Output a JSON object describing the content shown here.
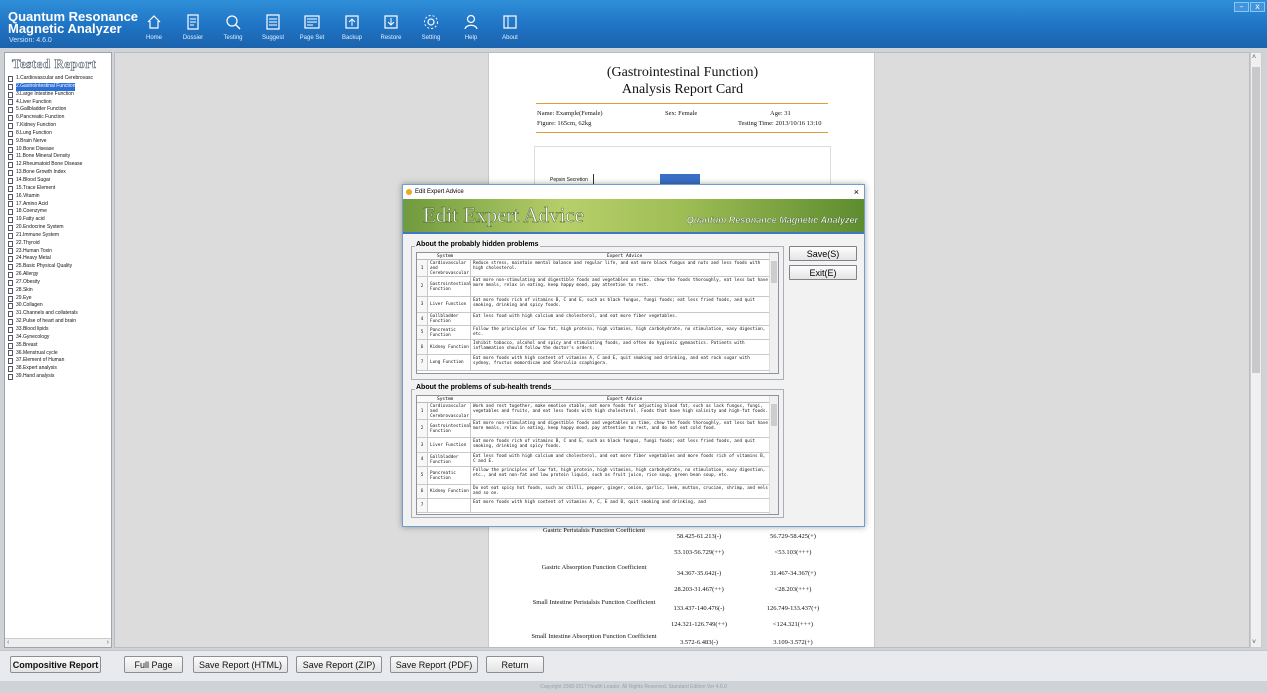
{
  "app": {
    "title_line1": "Quantum Resonance",
    "title_line2": "Magnetic Analyzer",
    "version": "Version: 4.6.0",
    "nav": [
      {
        "icon": "home-icon",
        "label": "Home"
      },
      {
        "icon": "dossier-icon",
        "label": "Dossier"
      },
      {
        "icon": "testing-icon",
        "label": "Testing"
      },
      {
        "icon": "suggest-icon",
        "label": "Suggest"
      },
      {
        "icon": "page-set-icon",
        "label": "Page Set"
      },
      {
        "icon": "backup-icon",
        "label": "Backup"
      },
      {
        "icon": "restore-icon",
        "label": "Restore"
      },
      {
        "icon": "setting-icon",
        "label": "Setting"
      },
      {
        "icon": "help-icon",
        "label": "Help"
      },
      {
        "icon": "about-icon",
        "label": "About"
      }
    ],
    "window_min": "–",
    "window_close": "x"
  },
  "sidebar": {
    "title": "Tested Report",
    "selected_index": 1,
    "items": [
      "1.Cardiovascular and Cerebrovasc",
      "2.Gastrointestinal Function",
      "3.Large Intestine Function",
      "4.Liver Function",
      "5.Gallbladder Function",
      "6.Pancreatic Function",
      "7.Kidney Function",
      "8.Lung Function",
      "9.Brain Nerve",
      "10.Bone Disease",
      "11.Bone Mineral Density",
      "12.Rheumatoid Bone Disease",
      "13.Bone Growth Index",
      "14.Blood Sugar",
      "15.Trace Element",
      "16.Vitamin",
      "17.Amino Acid",
      "18.Coenzyme",
      "19.Fatty acid",
      "20.Endocrine System",
      "21.Immune System",
      "22.Thyroid",
      "23.Human Toxin",
      "24.Heavy Metal",
      "25.Basic Physical Quality",
      "26.Allergy",
      "27.Obesity",
      "28.Skin",
      "29.Eye",
      "30.Collagen",
      "31.Channels and collaterals",
      "32.Pulse of heart and brain",
      "33.Blood lipids",
      "34.Gynecology",
      "35.Breast",
      "36.Menstrual cycle",
      "37.Element of Human",
      "38.Expert analysis",
      "39.Hand analysis"
    ],
    "compositive_button": "Compositive Report"
  },
  "report": {
    "title_line1": "(Gastrointestinal Function)",
    "title_line2": "Analysis Report Card",
    "name": "Name: Example(Female)",
    "sex": "Sex: Female",
    "age": "Age: 31",
    "figure": "Figure: 165cm, 62kg",
    "testing_time": "Testing Time: 2013/10/16 13:10",
    "chart_label": "Pepsin Secretion",
    "rows": [
      {
        "name": "Gastric Peristalsis Function Coefficient",
        "v1": "58.425-61.213(-)",
        "v2": "56.729-58.425(+)",
        "v3": "53.103-56.729(++)",
        "v4": "<53.103(+++)"
      },
      {
        "name": "Gastric Absorption Function Coefficient",
        "v1": "34.367-35.642(-)",
        "v2": "31.467-34.367(+)",
        "v3": "28.203-31.467(++)",
        "v4": "<28.203(+++)"
      },
      {
        "name": "Small Intestine Peristalsis Function Coefficient",
        "v1": "133.437-140.476(-)",
        "v2": "126.749-133.437(+)",
        "v3": "124.321-126.749(++)",
        "v4": "<124.321(+++)"
      },
      {
        "name": "Small Intestine Absorption Function Coefficient",
        "v1": "3.572-6.483(-)",
        "v2": "3.109-3.572(+)",
        "v3": "",
        "v4": ""
      }
    ]
  },
  "bottom_bar": {
    "full_page": "Full Page",
    "save_html": "Save Report (HTML)",
    "save_zip": "Save Report (ZIP)",
    "save_pdf": "Save Report (PDF)",
    "return": "Return"
  },
  "footer": "Copyright 2008-2017 Health Leader. All Rights Reserved.  Standard Edition Ver 4.6.0",
  "dialog": {
    "window_title": "Edit Expert Advice",
    "banner_title": "Edit Expert Advice",
    "banner_subtitle": "Quantum Resonance Magnetic Analyzer",
    "save_button": "Save(S)",
    "exit_button": "Exit(E)",
    "col_system": "System",
    "col_advice": "Expert Advice",
    "group1": {
      "caption": "About the probably hidden problems",
      "rows": [
        {
          "n": "1",
          "system": "Cardiovascular and Cerebrovascular",
          "advice": "Reduce stress, maintain mental balance and regular life, and eat more black fungus and nuts and less foods with high cholesterol."
        },
        {
          "n": "2",
          "system": "Gastrointestinal Function",
          "advice": "Eat more non-stimulating and digestible foods and vegetables on time, chew the foods thoroughly, eat less but have more meals, relax in eating, keep happy mood, pay attention to rest."
        },
        {
          "n": "3",
          "system": "Liver Function",
          "advice": "Eat more foods rich of vitamins B, C and E, such as black fungus, fungi foods; eat less fried foods, and quit smoking, drinking and spicy foods."
        },
        {
          "n": "4",
          "system": "Gallbladder Function",
          "advice": "Eat less food with high calcium and cholesterol, and eat more fiber vegetables."
        },
        {
          "n": "5",
          "system": "Pancreatic Function",
          "advice": "Follow the principles of low fat, high protein, high vitamins, high carbohydrate, no stimulation, easy digestion, etc."
        },
        {
          "n": "6",
          "system": "Kidney Function",
          "advice": "Inhibit tobacco, alcohol and spicy and stimulating foods, and often do hygienic gymnastics. Patients with inflammation should follow the doctor's orders."
        },
        {
          "n": "7",
          "system": "Lung Function",
          "advice": "Eat more foods with high content of vitamins A, C and E, quit smoking and drinking, and eat rock sugar with sydney, fructus momordicae and Sterculia scaphigera."
        }
      ]
    },
    "group2": {
      "caption": "About the problems of sub-health trends",
      "rows": [
        {
          "n": "1",
          "system": "Cardiovascular and Cerebrovascular",
          "advice": "Work and rest together, make emotion stable, eat more foods for adjusting blood fat, such as lack fungus, fungi, vegetables and fruits, and eat less foods with high cholesterol. Foods that have high salinity and high-fat foods."
        },
        {
          "n": "2",
          "system": "Gastrointestinal Function",
          "advice": "Eat more non-stimulating and digestible foods and vegetables on time, chew the foods thoroughly, eat less but have more meals, relax in eating, keep happy mood, pay attention to rest, and do not eat cold food."
        },
        {
          "n": "3",
          "system": "Liver Function",
          "advice": "Eat more foods rich of vitamins B, C and E, such as black fungus, fungi foods; eat less fried foods, and quit smoking, drinking and spicy foods."
        },
        {
          "n": "4",
          "system": "Gallbladder Function",
          "advice": "Eat less food with high calcium and cholesterol, and eat more fiber vegetables and more foods rich of vitamins B, C and E."
        },
        {
          "n": "5",
          "system": "Pancreatic Function",
          "advice": "Follow the principles of low fat, high protein, high vitamins, high carbohydrate, no stimulation, easy digestion, etc., and eat non-fat and low protein liquid, such as fruit juice, rice soup, green bean soup, etc."
        },
        {
          "n": "6",
          "system": "Kidney Function",
          "advice": "Do not eat spicy hot foods, such as chilli, pepper, ginger, onion, garlic, leek, mutton, crucian, shrimp, and eels and so on."
        },
        {
          "n": "7",
          "system": "",
          "advice": "Eat more foods with high content of vitamins A, C, E and B, quit smoking and drinking, and"
        }
      ]
    }
  }
}
